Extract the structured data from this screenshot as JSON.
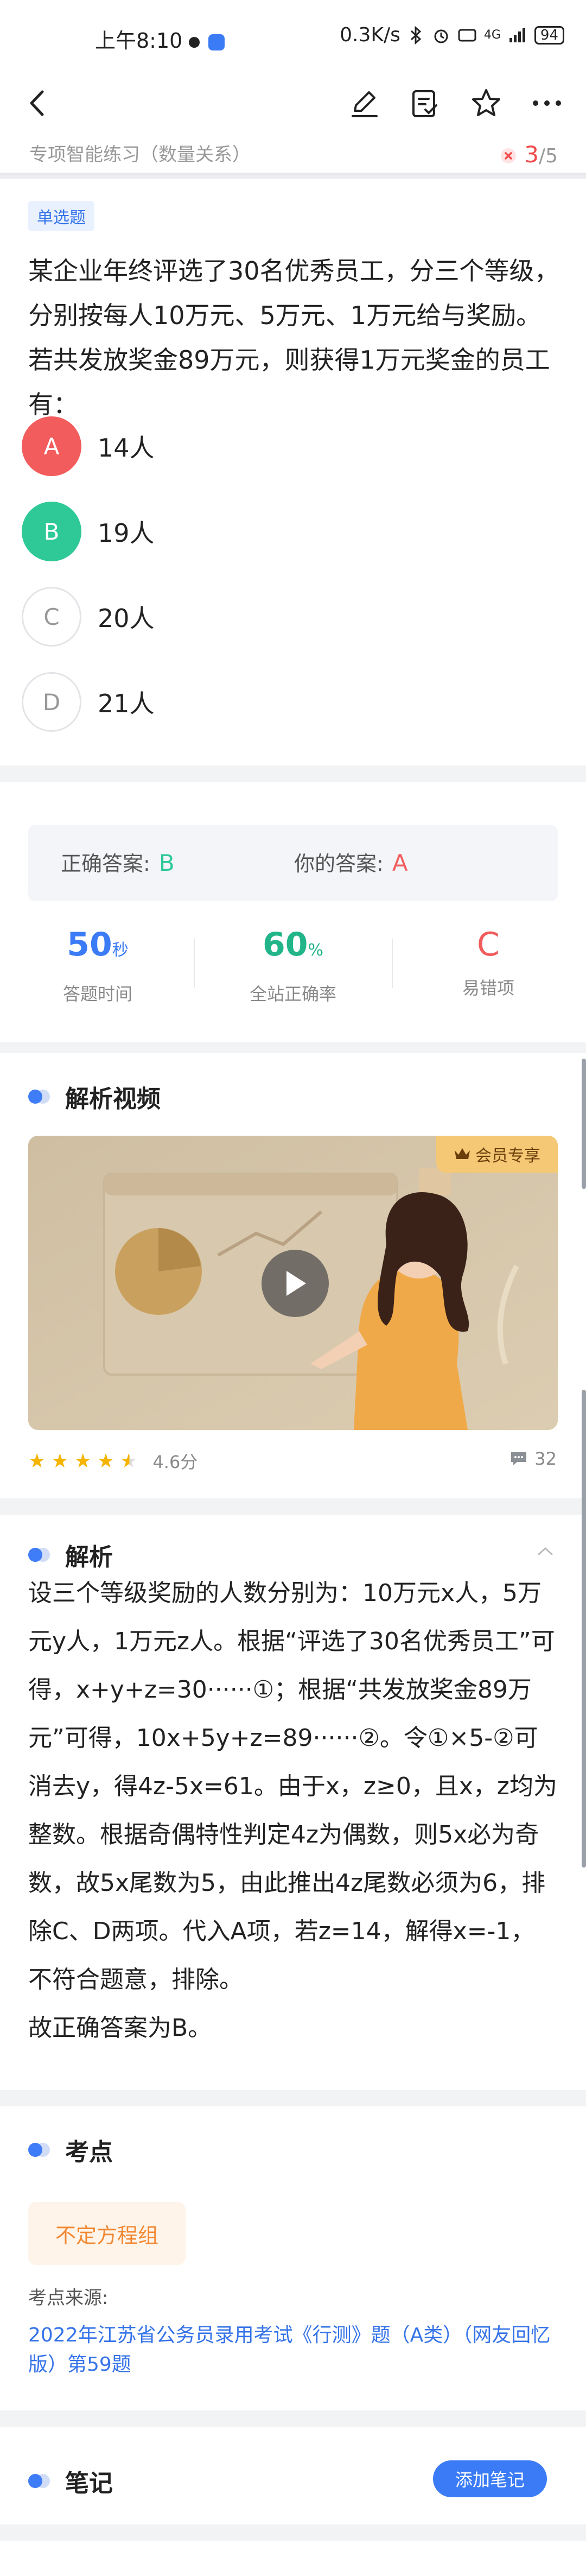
{
  "status_bar": {
    "time": "上午8:10",
    "speed": "0.3K/s",
    "network": "4G",
    "battery": "94"
  },
  "icons": {
    "back": "back-arrow-icon",
    "edit": "pencil-icon",
    "answer_sheet": "answer-sheet-icon",
    "favorite": "star-icon",
    "more": "more-icon"
  },
  "sub_header": {
    "title": "专项智能练习（数量关系）",
    "current": "3",
    "total": "/5"
  },
  "question": {
    "type_tag": "单选题",
    "text": "某企业年终评选了30名优秀员工，分三个等级，分别按每人10万元、5万元、1万元给与奖励。若共发放奖金89万元，则获得1万元奖金的员工有：",
    "options": [
      {
        "letter": "A",
        "text": "14人"
      },
      {
        "letter": "B",
        "text": "19人"
      },
      {
        "letter": "C",
        "text": "20人"
      },
      {
        "letter": "D",
        "text": "21人"
      }
    ]
  },
  "answer": {
    "correct_label": "正确答案:",
    "correct_value": "B",
    "yours_label": "你的答案:",
    "yours_value": "A",
    "stats": [
      {
        "value": "50",
        "unit": "秒",
        "caption": "答题时间"
      },
      {
        "value": "60",
        "unit": "%",
        "caption": "全站正确率"
      },
      {
        "value": "C",
        "unit": "",
        "caption": "易错项"
      }
    ]
  },
  "video": {
    "heading": "解析视频",
    "vip_label": "会员专享",
    "rating": "4.6分",
    "comments": "32"
  },
  "analysis": {
    "heading": "解析",
    "text": "设三个等级奖励的人数分别为：10万元x人，5万元y人，1万元z人。根据“评选了30名优秀员工”可得，x+y+z=30······①；根据“共发放奖金89万元”可得，10x+5y+z=89······②。令①×5-②可消去y，得4z-5x=61。由于x，z≥0，且x，z均为整数。根据奇偶特性判定4z为偶数，则5x必为奇数，故5x尾数为5，由此推出4z尾数必须为6，排除C、D两项。代入A项，若z=14，解得x=-1，不符合题意，排除。",
    "conclusion": "故正确答案为B。"
  },
  "kaodian": {
    "heading": "考点",
    "tag": "不定方程组",
    "source_label": "考点来源:",
    "source": "2022年江苏省公务员录用考试《行测》题（A类）（网友回忆版）第59题"
  },
  "notes": {
    "heading": "笔记",
    "add_label": "添加笔记"
  },
  "colors": {
    "accent": "#3b7bf6",
    "correct": "#2ec997",
    "wrong": "#f25c5c",
    "accuracy": "#22b58a"
  }
}
